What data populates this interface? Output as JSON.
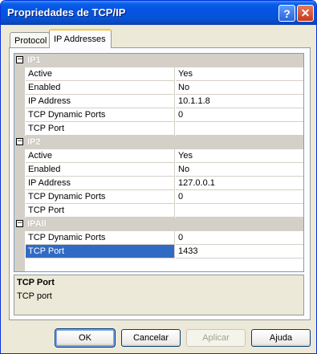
{
  "window": {
    "title": "Propriedades de TCP/IP",
    "help_glyph": "?",
    "close_glyph": "✕"
  },
  "tabs": [
    {
      "label": "Protocol"
    },
    {
      "label": "IP Addresses"
    }
  ],
  "grid": {
    "expander_glyph": "−",
    "categories": [
      {
        "label": "IP1",
        "rows": [
          {
            "name": "Active",
            "value": "Yes"
          },
          {
            "name": "Enabled",
            "value": "No"
          },
          {
            "name": "IP Address",
            "value": "10.1.1.8"
          },
          {
            "name": "TCP Dynamic Ports",
            "value": "0"
          },
          {
            "name": "TCP Port",
            "value": ""
          }
        ]
      },
      {
        "label": "IP2",
        "rows": [
          {
            "name": "Active",
            "value": "Yes"
          },
          {
            "name": "Enabled",
            "value": "No"
          },
          {
            "name": "IP Address",
            "value": "127.0.0.1"
          },
          {
            "name": "TCP Dynamic Ports",
            "value": "0"
          },
          {
            "name": "TCP Port",
            "value": ""
          }
        ]
      },
      {
        "label": "IPAll",
        "rows": [
          {
            "name": "TCP Dynamic Ports",
            "value": "0"
          },
          {
            "name": "TCP Port",
            "value": "1433",
            "selected": true
          }
        ]
      }
    ]
  },
  "description": {
    "title": "TCP Port",
    "text": "TCP port"
  },
  "buttons": {
    "ok": "OK",
    "cancel": "Cancelar",
    "apply": "Aplicar",
    "help": "Ajuda"
  }
}
